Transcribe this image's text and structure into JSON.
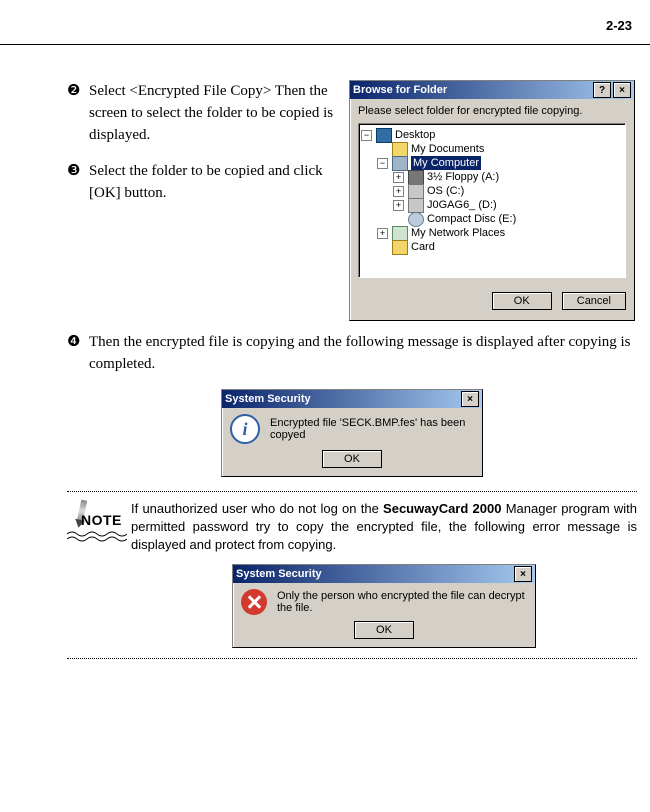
{
  "page_number": "2-23",
  "steps": {
    "s2_num": "❷",
    "s2_text": "Select <Encrypted File Copy> Then the screen to select the folder to be copied is displayed.",
    "s3_num": "❸",
    "s3_text": "Select the folder to be copied and click [OK] button.",
    "s4_num": "❹",
    "s4_text": "Then the encrypted file is copying and the following message is displayed after copying is completed."
  },
  "browse_dialog": {
    "title": "Browse for Folder",
    "help_label": "?",
    "close_label": "×",
    "prompt": "Please select folder for encrypted file copying.",
    "ok_label": "OK",
    "cancel_label": "Cancel",
    "tree": {
      "desktop": {
        "label": "Desktop",
        "box": "−"
      },
      "my_documents": {
        "label": "My Documents"
      },
      "my_computer": {
        "label": "My Computer",
        "box": "−",
        "selected": true
      },
      "floppy": {
        "label": "3½ Floppy (A:)",
        "box": "+"
      },
      "os_c": {
        "label": "OS (C:)",
        "box": "+"
      },
      "d_drive": {
        "label": "J0GAG6_ (D:)",
        "box": "+"
      },
      "cd_e": {
        "label": "Compact Disc (E:)"
      },
      "net_places": {
        "label": "My Network Places",
        "box": "+"
      },
      "card": {
        "label": "Card"
      }
    }
  },
  "copied_dialog": {
    "title": "System Security",
    "close_label": "×",
    "message": "Encrypted file 'SECK.BMP.fes' has been copyed",
    "ok_label": "OK"
  },
  "error_dialog": {
    "title": "System Security",
    "close_label": "×",
    "message": "Only the person who encrypted the file can decrypt the file.",
    "ok_label": "OK"
  },
  "note": {
    "label": "NOTE",
    "pre": "If unauthorized user who do not log on the ",
    "product": "SecuwayCard 2000",
    "post": " Manager program with permitted password try to copy the encrypted file, the following error message is displayed and protect from copying."
  }
}
